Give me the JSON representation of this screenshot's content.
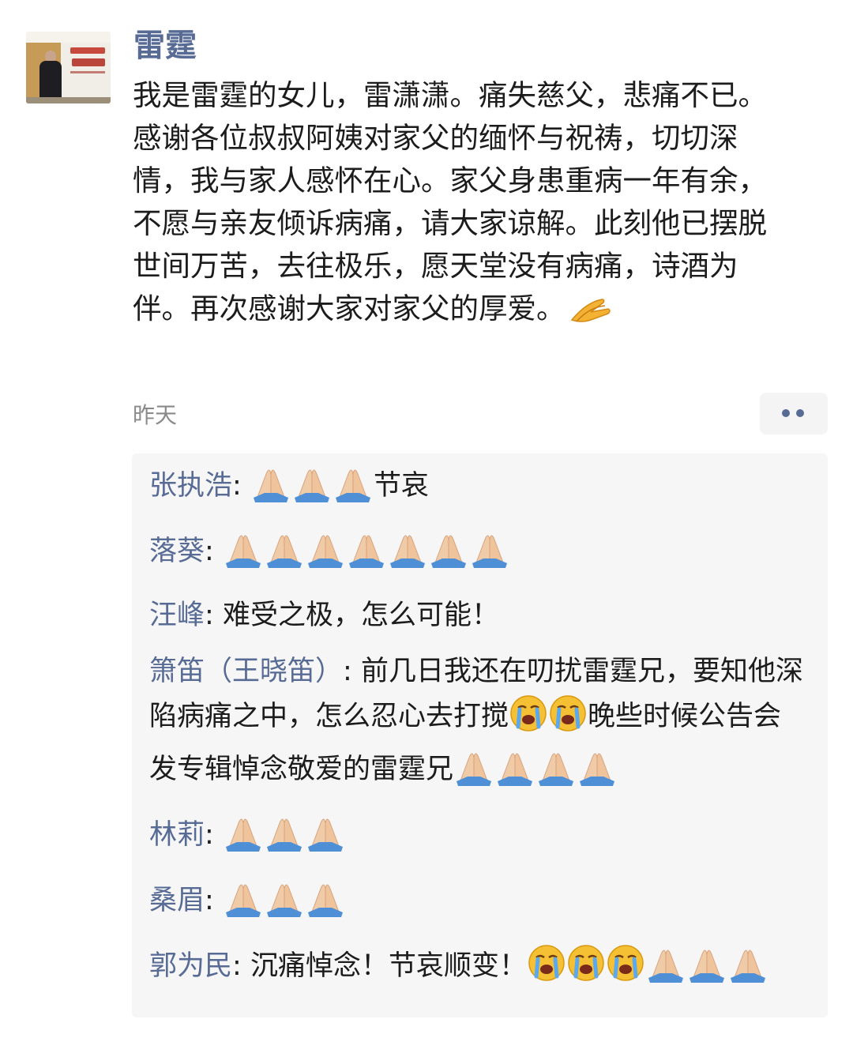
{
  "post": {
    "author": "雷霆",
    "text": "我是雷霆的女儿，雷潇潇。痛失慈父，悲痛不已。感谢各位叔叔阿姨对家父的缅怀与祝祷，切切深情，我与家人感怀在心。家父身患重病一年有余，不愿与亲友倾诉病痛，请大家谅解。此刻他已摆脱世间万苦，去往极乐，愿天堂没有病痛，诗酒为伴。再次感谢大家对家父的厚爱。",
    "trailing_emoji": "clap-hand-icon",
    "time": "昨天",
    "more_icon": "more-dots-icon"
  },
  "comments": [
    {
      "name": "张执浩",
      "sep": ": ",
      "pray_before": 3,
      "text": "节哀",
      "cry_after": 0,
      "pray_after": 0
    },
    {
      "name": "落葵",
      "sep": ": ",
      "pray_before": 7,
      "text": "",
      "cry_after": 0,
      "pray_after": 0
    },
    {
      "name": "汪峰",
      "sep": ": ",
      "pray_before": 0,
      "text": "难受之极，怎么可能！",
      "cry_after": 0,
      "pray_after": 0
    },
    {
      "name": "箫笛（王晓笛）",
      "sep": ": ",
      "pray_before": 0,
      "text": "前几日我还在叨扰雷霆兄，要知他深陷病痛之中，怎么忍心去打搅",
      "cry_after": 2,
      "text2": "晚些时候公告会发专辑悼念敬爱的雷霆兄",
      "pray_after": 4
    },
    {
      "name": "林莉",
      "sep": ": ",
      "pray_before": 3,
      "text": "",
      "cry_after": 0,
      "pray_after": 0
    },
    {
      "name": "桑眉",
      "sep": ": ",
      "pray_before": 3,
      "text": "",
      "cry_after": 0,
      "pray_after": 0
    },
    {
      "name": "郭为民",
      "sep": ": ",
      "pray_before": 0,
      "text": "沉痛悼念！节哀顺变！",
      "cry_after": 3,
      "pray_after": 3
    }
  ],
  "colors": {
    "link": "#576b95",
    "text": "#1c1c1c",
    "time": "#8a8a8a",
    "comment_bg": "#f6f6f6"
  }
}
